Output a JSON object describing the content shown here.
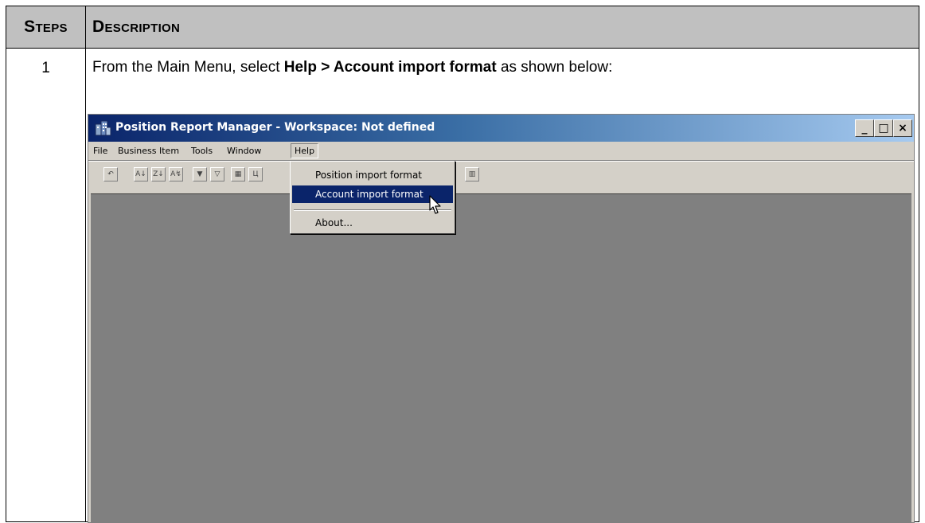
{
  "table": {
    "header_steps": "Steps",
    "header_description": "Description",
    "rows": [
      {
        "step": "1",
        "instruction_prefix": "From the Main Menu, select ",
        "instruction_bold": "Help > Account import format",
        "instruction_suffix": " as shown below:"
      }
    ]
  },
  "screenshot": {
    "window_title": "Position Report Manager - Workspace: Not defined",
    "window_buttons": [
      "_",
      "□",
      "×"
    ],
    "menu": [
      "File",
      "Business Item",
      "Tools",
      "Window",
      "Help"
    ],
    "dropdown_items": [
      {
        "label": "Position import format",
        "active": false
      },
      {
        "label": "Account import format",
        "active": true
      },
      {
        "label": "About...",
        "active": false
      }
    ],
    "colors": {
      "title_start": "#0a246a",
      "title_end": "#a6caf0",
      "workspace": "#808080",
      "highlight": "#0a246a"
    }
  }
}
